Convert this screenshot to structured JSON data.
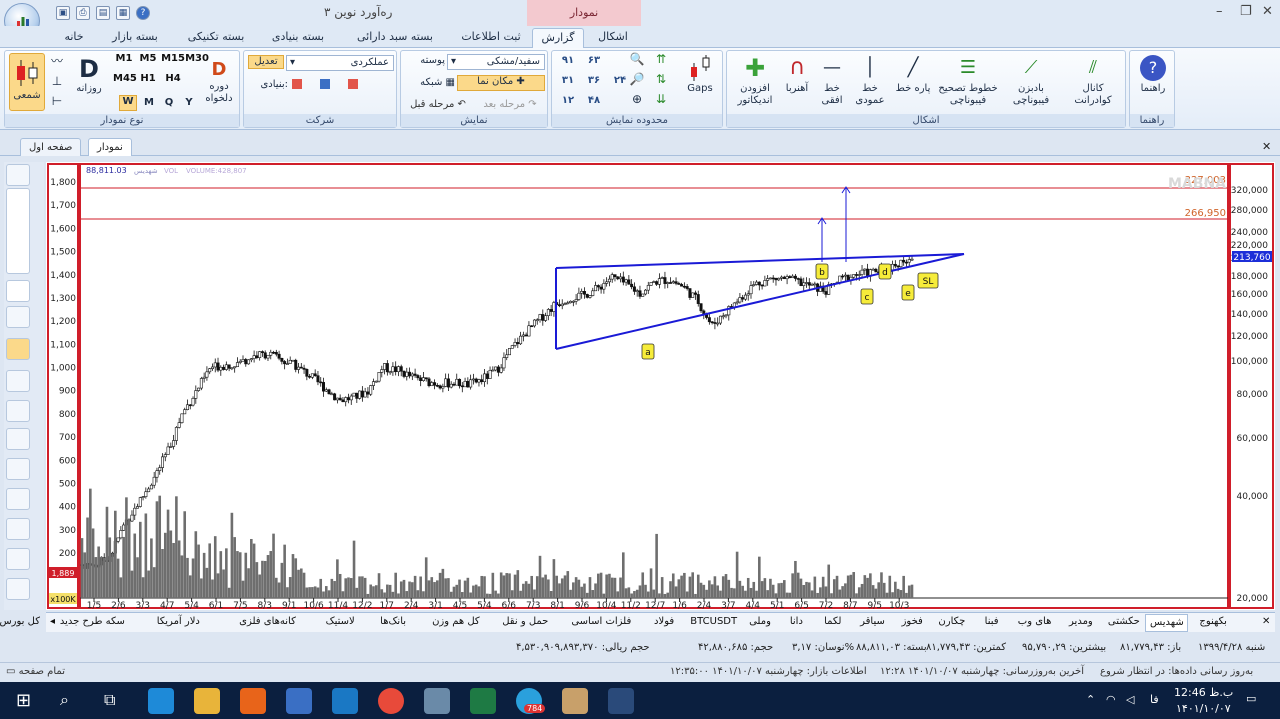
{
  "window": {
    "title": "ره‌آورد نوین ۳",
    "contextual_tab": "نمودار"
  },
  "ribbon_tabs": [
    "خانه",
    "بسته بازار",
    "بسته تکنیکی",
    "بسته بنیادی",
    "بسته سبد دارائی",
    "ثبت اطلاعات",
    "گزارش",
    "اشکال"
  ],
  "active_tab": "گزارش",
  "groups": {
    "chart_type": {
      "caption": "نوع نمودار",
      "candle_label": "شمعی",
      "daily_label": "روزانه",
      "periodic_label": "دوره دلخواه",
      "d_letter": "D",
      "periods": [
        "M1",
        "M5",
        "M15",
        "M30",
        "H1",
        "H4",
        "M45",
        "H1",
        "H4"
      ],
      "wmqy": [
        "W",
        "M",
        "Q",
        "Y"
      ]
    },
    "company": {
      "caption": "شرکت",
      "edit_label": "تعدیل",
      "select_value": "عملکردی",
      "fundamental_label": "بنیادی:"
    },
    "display": {
      "caption": "نمایش",
      "skin_value": "سفید/مشکی",
      "skin_label": "پوسته",
      "grid_label": "شبکه",
      "cursor_label": "مکان نما",
      "prev_label": "مرحله قبل",
      "next_label": "مرحله بعد"
    },
    "range": {
      "caption": "محدوده نمایش",
      "gaps_label": "Gaps",
      "nums": [
        "۹۱",
        "۶۳",
        "۳۱",
        "۳۶",
        "۲۴",
        "۱۲",
        "۴۸"
      ]
    },
    "shapes": {
      "caption": "اشکال",
      "items": [
        "کانال کوادرانت",
        "بادبزن فیبوناچی",
        "خطوط تصحیح فیبوناچی",
        "پاره خط",
        "خط عمودی",
        "خط افقی",
        "آهنربا",
        "افزودن اندیکاتور"
      ]
    },
    "help": {
      "caption": "راهنما",
      "label": "راهنما"
    }
  },
  "doc_tabs": [
    "صفحه اول",
    "نمودار"
  ],
  "chart_header": {
    "price_text": "88,811.03",
    "label_text": "شهدیس",
    "vol_text": "VOL",
    "volume_text": "VOLUME:428,807",
    "watermark": "MABNA"
  },
  "chart_data": {
    "type": "candlestick",
    "left_axis": [
      1800,
      1700,
      1600,
      1500,
      1400,
      1300,
      1200,
      1100,
      1000,
      900,
      800,
      700,
      600,
      500,
      400,
      300,
      200
    ],
    "right_axis_log": [
      320000,
      280000,
      240000,
      220000,
      200000,
      180000,
      160000,
      140000,
      120000,
      100000,
      80000,
      60000,
      40000,
      20000
    ],
    "x_labels": [
      "1/5",
      "2/6",
      "3/3",
      "4/7",
      "5/4",
      "6/1",
      "7/5",
      "8/3",
      "9/1",
      "10/6",
      "11/4",
      "12/2",
      "1/7",
      "2/4",
      "3/1",
      "4/5",
      "5/4",
      "6/6",
      "7/3",
      "8/1",
      "9/6",
      "10/4",
      "11/2",
      "12/7",
      "1/6",
      "2/4",
      "3/7",
      "4/4",
      "5/1",
      "6/5",
      "7/2",
      "8/7",
      "9/5",
      "10/3"
    ],
    "h_levels": [
      {
        "value": 327003,
        "label": "327,003"
      },
      {
        "value": 266950,
        "label": "266,950"
      }
    ],
    "last_value_label": "213,760",
    "left_badges": {
      "volume": "1,889",
      "scale": "x100K"
    },
    "pattern_labels": [
      "a",
      "b",
      "c",
      "d",
      "e",
      "SL"
    ],
    "close_path": [
      150,
      148,
      190,
      330,
      420,
      520,
      640,
      800,
      900,
      1000,
      1010,
      1020,
      1050,
      1060,
      1030,
      1005,
      960,
      910,
      860,
      870,
      900,
      1000,
      990,
      960,
      940,
      930,
      935,
      925,
      950,
      990,
      1080,
      1150,
      1210,
      1270,
      1300,
      1310,
      1340,
      1390,
      1360,
      1320,
      1370,
      1380,
      1350,
      1290,
      1180,
      1240,
      1300,
      1360,
      1380,
      1385,
      1370,
      1350,
      1330,
      1380,
      1400,
      1410,
      1420,
      1450,
      1480
    ]
  },
  "stock_tabs": [
    "بکهنوج",
    "شهدیس",
    "حکشتی",
    "ومدیر",
    "های وب",
    "فبنا",
    "چکارن",
    "فخوز",
    "سیاقر",
    "لکما",
    "دانا",
    "وملی",
    "BTCUSDT",
    "فولاد",
    "فلزات اساسی",
    "حمل و نقل",
    "کل هم وزن",
    "بانک‌ها",
    "لاستیک",
    "کانه‌های فلزی",
    "دلار آمریکا",
    "سکه طرح جدید",
    "کل بورس"
  ],
  "active_stock": "شهدیس",
  "info_items": [
    "شنبه ۱۳۹۹/۴/۲۸",
    "باز: ۸۱,۷۷۹,۴۳",
    "بیشترین: ۹۵,۷۹۰,۲۹",
    "کمترین: ۸۱,۷۷۹,۴۳",
    "بسته: ۸۸,۸۱۱,۰۳",
    "نوسان: ۳,۱۷%",
    "حجم: ۴۲,۸۸۰,۶۸۵",
    "حجم ریالی: ۴,۵۳۰,۹۰۹,۸۹۳,۳۷۰"
  ],
  "status": {
    "left": "تمام صفحه",
    "right": "به‌روز رسانی داده‌ها: در انتظار شروع",
    "last_update": "آخرین به‌روزرسانی: چهارشنبه ۱۴۰۱/۱۰/۰۷ ۱۲:۲۸",
    "market_info": "اطلاعات بازار: چهارشنبه ۱۴۰۱/۱۰/۰۷ ۱۲:۳۵:۰۰"
  },
  "taskbar": {
    "time": "12:46 ب.ظ",
    "date": "۱۴۰۱/۱۰/۰۷",
    "lang": "فا",
    "badge": "784"
  }
}
